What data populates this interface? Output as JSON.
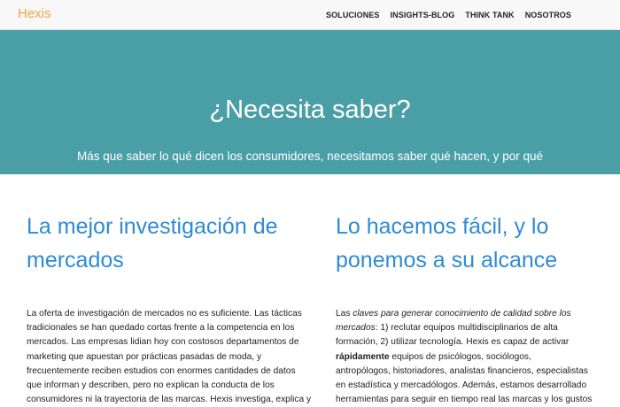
{
  "navbar": {
    "brand": "Hexis",
    "links": [
      "SOLUCIONES",
      "INSIGHTS-BLOG",
      "THINK TANK",
      "NOSOTROS"
    ]
  },
  "hero": {
    "title": "¿Necesita saber?",
    "subtitle": "Más que saber lo qué dicen los consumidores, necesitamos saber qué hacen, y por qué"
  },
  "left_column": {
    "heading_lines": [
      "La mejor investigación de",
      "mercados"
    ],
    "body_lines": [
      "La oferta de investigación de mercados no es suficiente. Las tácticas",
      "tradicionales se han quedado cortas frente a la competencia en los",
      "mercados. Las empresas lidian hoy con costosos departamentos de",
      "marketing que apuestan por prácticas pasadas de moda, y",
      "frecuentemente reciben estudios con enormes cantidades de datos",
      "que informan y describen, pero no explican la conducta de los",
      "consumidores ni la trayectoria de las marcas. Hexis investiga, explica y"
    ]
  },
  "right_column": {
    "heading_lines": [
      "Lo hacemos fácil, y lo",
      "ponemos a su alcance"
    ],
    "body": {
      "line1_pre": "Las ",
      "line1_em": "claves para generar conocimiento de calidad sobre los",
      "line2_em": "mercados",
      "line2_post": ": 1) reclutar equipos multidisciplinarios de alta",
      "line3": "formación, 2) utilizar tecnología. Hexis es capaz de activar",
      "line4_strong": "rápidamente",
      "line4_post": " equipos de psicólogos, sociólogos,",
      "line5": "antropólogos, historiadores, analistas financieros, especialistas",
      "line6": "en estadística y mercadólogos. Además, estamos desarrollado",
      "line7": "herramientas para seguir en tiempo real las marcas y los gustos"
    }
  }
}
